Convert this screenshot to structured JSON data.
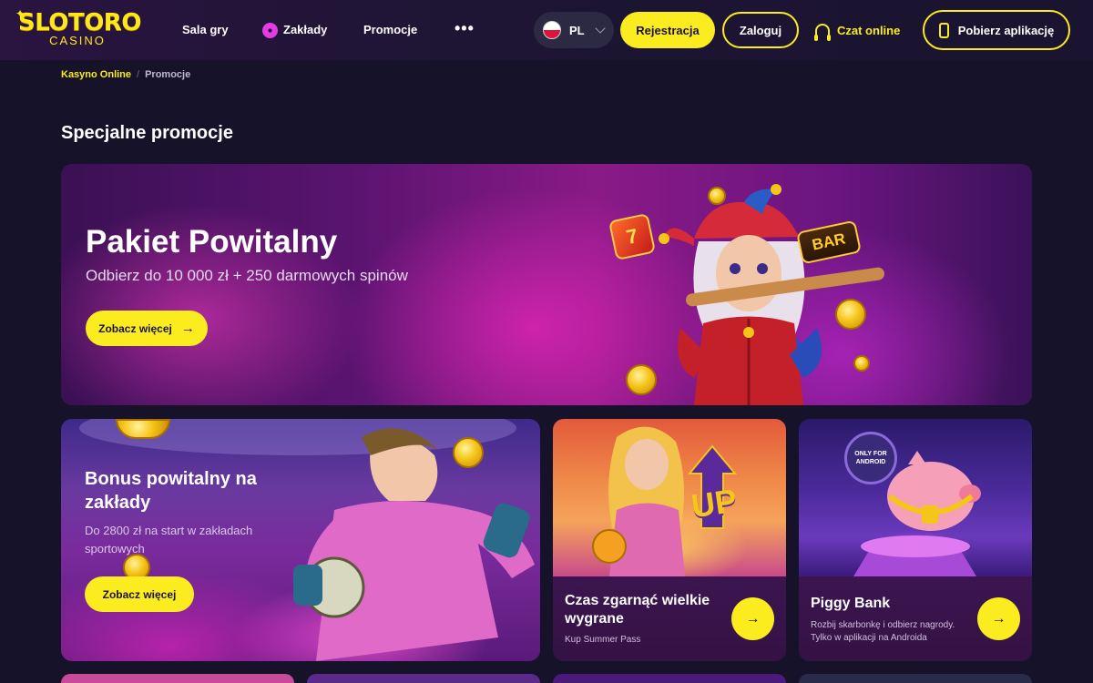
{
  "header": {
    "logo_text": "SLOTORO",
    "logo_sub": "CASINO",
    "nav": [
      {
        "label": "Sala gry"
      },
      {
        "label": "Zakłady",
        "icon": "soccer-ball-icon"
      },
      {
        "label": "Promocje"
      },
      {
        "label": "•••"
      }
    ],
    "language": "PL",
    "register_label": "Rejestracja",
    "login_label": "Zaloguj",
    "chat_label": "Czat online",
    "app_label": "Pobierz aplikację"
  },
  "breadcrumb": {
    "home": "Kasyno Online",
    "separator": "/",
    "current": "Promocje"
  },
  "page_title": "Specjalne promocje",
  "hero": {
    "title": "Pakiet Powitalny",
    "subtitle": "Odbierz do 10 000 zł + 250 darmowych spinów",
    "button_label": "Zobacz więcej",
    "badge_text": "BAR",
    "die_text": "7"
  },
  "cards": [
    {
      "title": "Bonus powitalny na zakłady",
      "subtitle": "Do 2800 zł na start w zakładach sportowych",
      "button_label": "Zobacz więcej"
    },
    {
      "title": "Czas zgarnąć wielkie wygrane",
      "subtitle": "Kup Summer Pass",
      "art_text": "UP"
    },
    {
      "title": "Piggy Bank",
      "subtitle": "Rozbij skarbonkę i odbierz nagrody. Tylko w aplikacji na Androida",
      "badge_text": "ONLY FOR ANDROID"
    }
  ],
  "colors": {
    "accent": "#fbec1f",
    "background": "#15122a",
    "header": "#1d1533",
    "card_bottom": "#3c1550"
  }
}
